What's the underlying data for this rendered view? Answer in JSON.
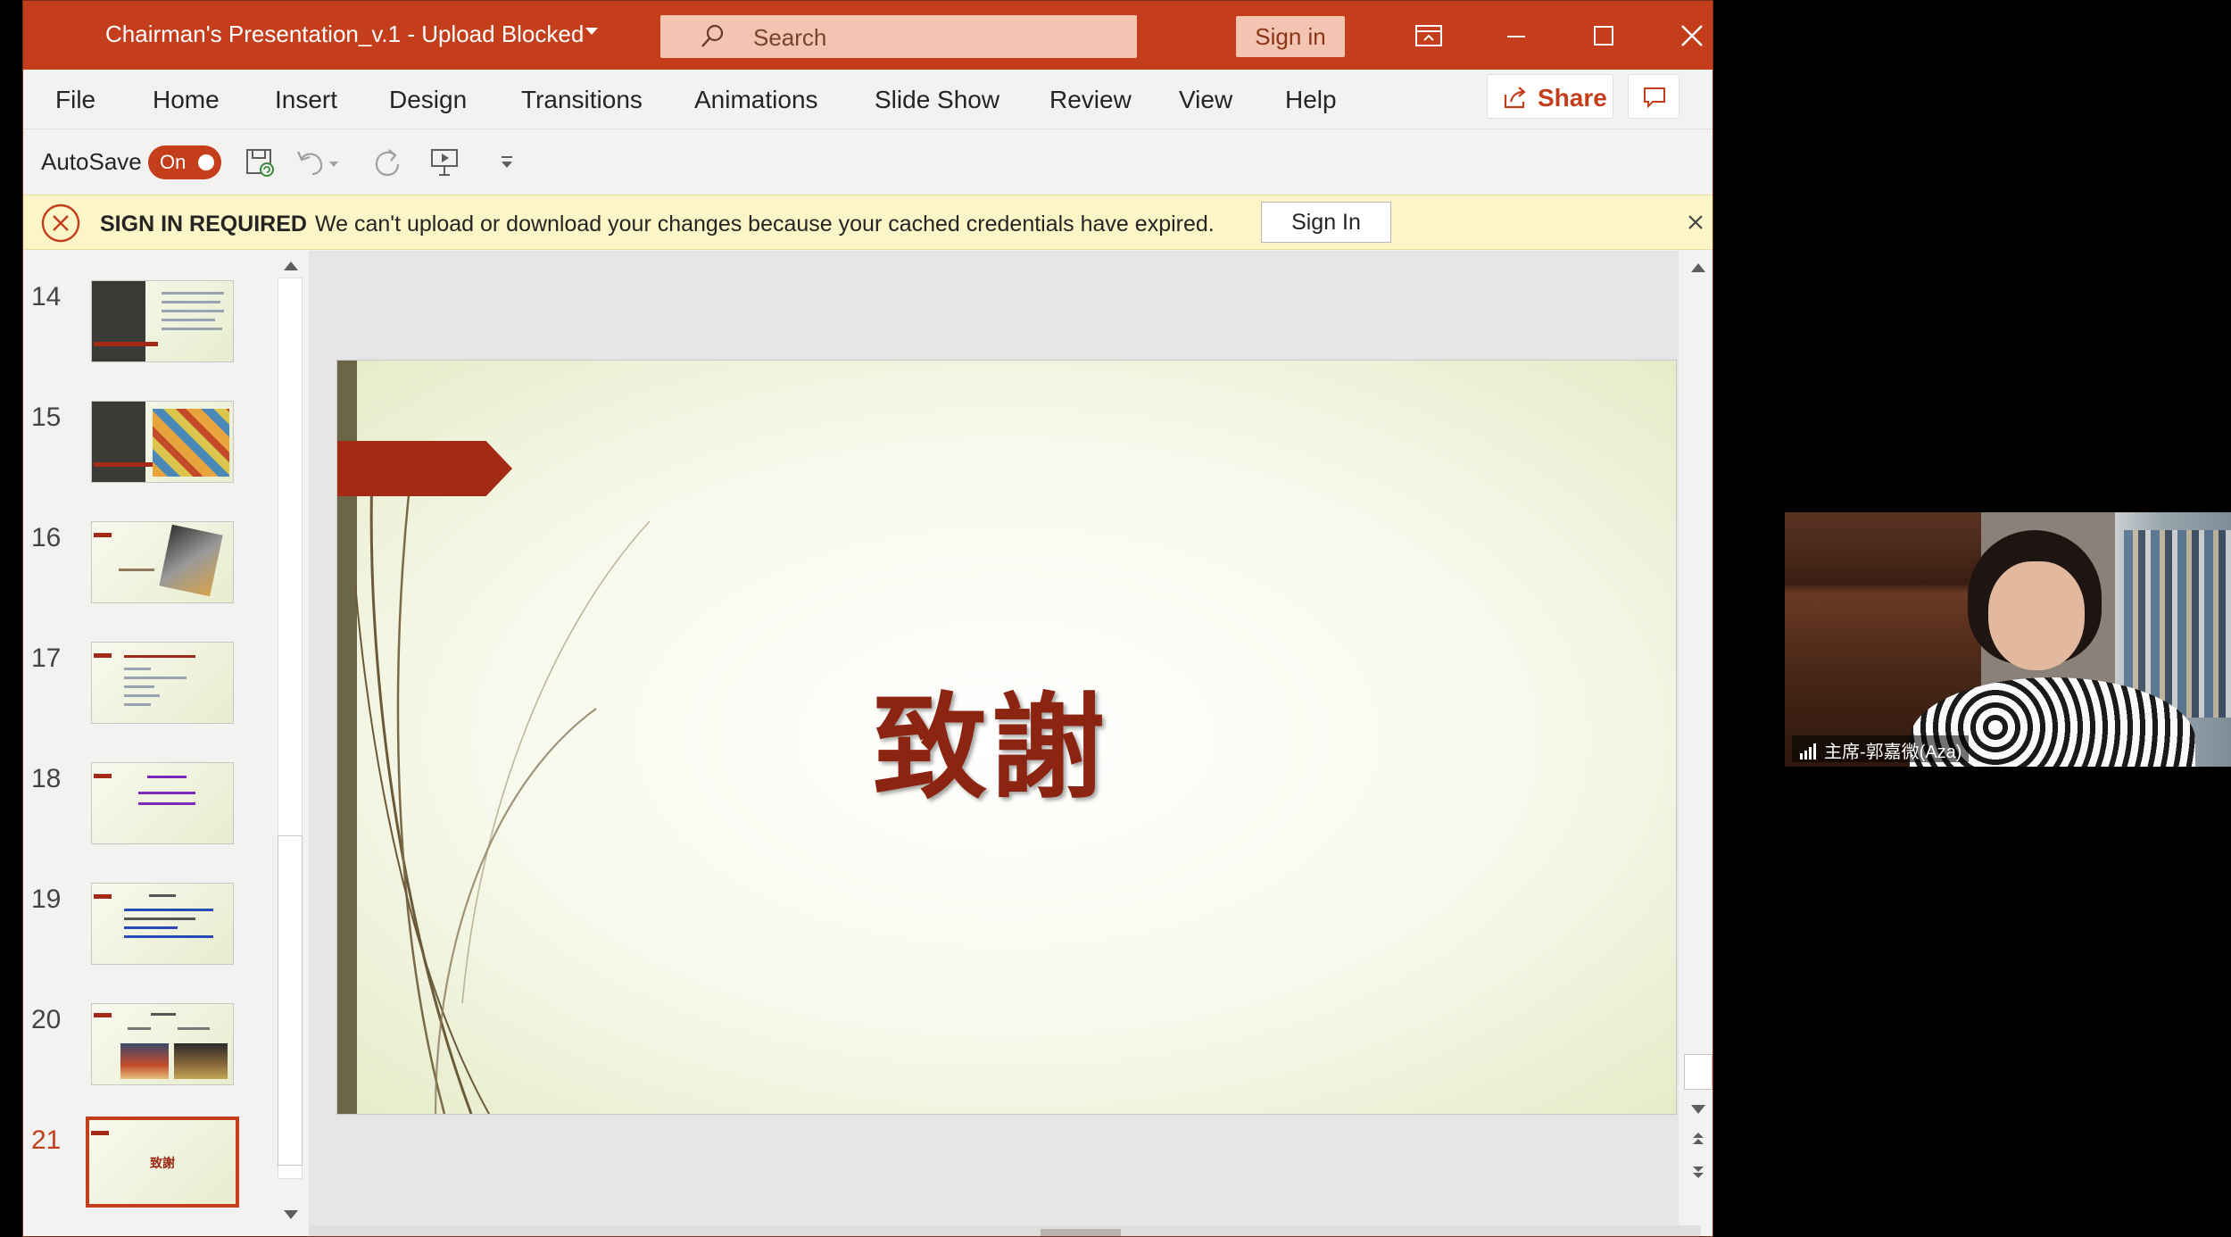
{
  "colors": {
    "accent": "#c43e1c",
    "slide_title": "#8b2512",
    "infobar_bg": "#fcf5c7"
  },
  "titlebar": {
    "doc_title": "Chairman's Presentation_v.1  -  Upload Blocked",
    "search_placeholder": "Search",
    "sign_in": "Sign in",
    "icons": [
      "search-icon",
      "ribbon-display-icon",
      "minimize-icon",
      "maximize-icon",
      "close-icon"
    ]
  },
  "menu": {
    "items": [
      "File",
      "Home",
      "Insert",
      "Design",
      "Transitions",
      "Animations",
      "Slide Show",
      "Review",
      "View",
      "Help"
    ],
    "share": "Share"
  },
  "qat": {
    "autosave_label": "AutoSave",
    "autosave_state": "On",
    "icons": [
      "save-icon",
      "undo-icon",
      "redo-icon",
      "present-icon",
      "customize-icon"
    ]
  },
  "infobar": {
    "title": "SIGN IN REQUIRED",
    "message": "We can't upload or download your changes because your cached credentials have expired.",
    "button": "Sign In"
  },
  "thumbnails": {
    "numbers": [
      "14",
      "15",
      "16",
      "17",
      "18",
      "19",
      "20",
      "21"
    ],
    "selected": "21"
  },
  "slide": {
    "title": "致謝"
  },
  "video": {
    "participant_name": "主席-郭嘉微(Aza)"
  }
}
